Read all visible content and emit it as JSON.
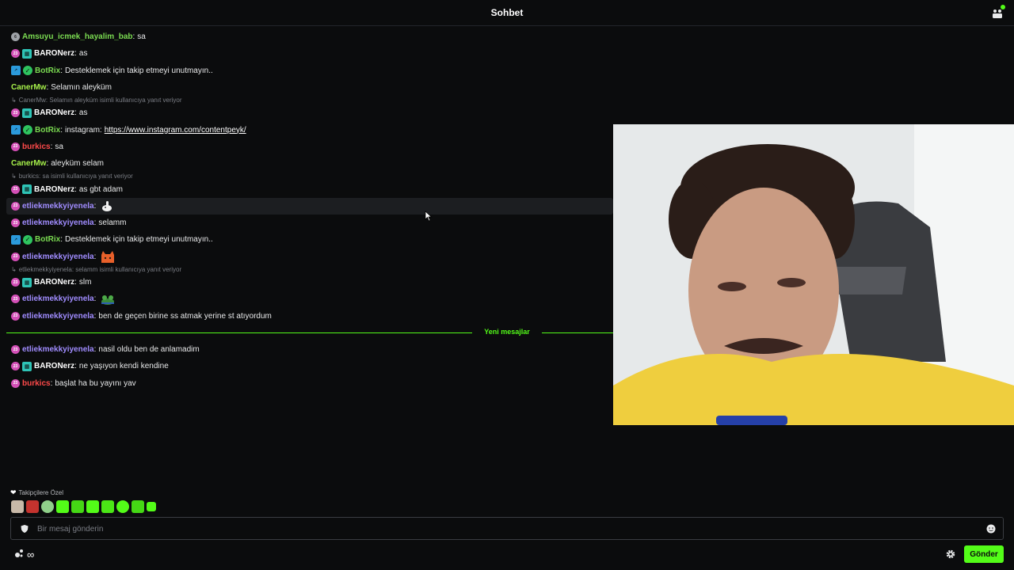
{
  "header": {
    "title": "Sohbet",
    "users_icon": "users-icon"
  },
  "messages": [
    {
      "user": "Amsuyu_icmek_hayalim_bab",
      "text": "sa"
    },
    {
      "user": "BARONerz",
      "text": "as"
    },
    {
      "user": "BotRix",
      "text": "Desteklemek için takip etmeyi unutmayın.."
    },
    {
      "user": "CanerMw",
      "text": "Selamın aleyküm"
    },
    {
      "reply": "CanerMw: Selamın aleyküm isimli kullanıcıya yanıt veriyor"
    },
    {
      "user": "BARONerz",
      "text": "as"
    },
    {
      "user": "BotRix",
      "text": "instagram: ",
      "link": "https://www.instagram.com/contentpeyk/"
    },
    {
      "user": "burkics",
      "text": "sa"
    },
    {
      "user": "CanerMw",
      "text": "aleyküm selam"
    },
    {
      "reply": "burkics: sa isimli kullanıcıya yanıt veriyor"
    },
    {
      "user": "BARONerz",
      "text": "as gbt adam"
    },
    {
      "user": "etliekmekkyiyenela",
      "emote": "thumbsup-emote"
    },
    {
      "user": "etliekmekkyiyenela",
      "text": "selamm"
    },
    {
      "user": "BotRix",
      "text": "Desteklemek için takip etmeyi unutmayın.."
    },
    {
      "user": "etliekmekkyiyenela",
      "emote": "cat-emote"
    },
    {
      "reply": "etliekmekkyiyenela: selamm isimli kullanıcıya yanıt veriyor"
    },
    {
      "user": "BARONerz",
      "text": "slm"
    },
    {
      "user": "etliekmekkyiyenela",
      "emote": "frog-emote"
    },
    {
      "user": "etliekmekkyiyenela",
      "text": "ben de geçen birine ss atmak yerine st atıyordum"
    }
  ],
  "divider_label": "Yeni mesajlar",
  "new_messages": [
    {
      "user": "etliekmekkyiyenela",
      "text": "nasil oldu ben de anlamadim"
    },
    {
      "user": "BARONerz",
      "text": "ne yaşıyon kendi kendine"
    },
    {
      "user": "burkics",
      "text": "başlat ha bu yayını yav"
    }
  ],
  "badge_labels": {
    "sub": "23",
    "amsuyu": "6"
  },
  "follower_label": "Takipçilere Özel",
  "input": {
    "placeholder": "Bir mesaj gönderin"
  },
  "send_label": "Gönder",
  "colors": {
    "accent": "#53fc18",
    "background": "#0b0c0d",
    "sub_badge": "#d34fb6"
  }
}
